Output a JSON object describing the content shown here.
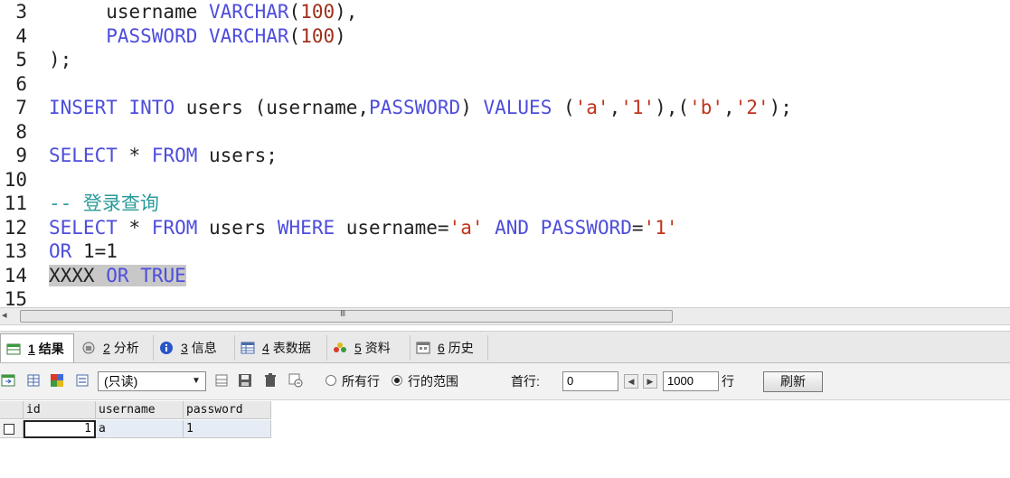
{
  "editor": {
    "lines": [
      {
        "no": "3",
        "tokens": [
          {
            "t": "     username ",
            "c": ""
          },
          {
            "t": "VARCHAR",
            "c": "kw"
          },
          {
            "t": "(",
            "c": ""
          },
          {
            "t": "100",
            "c": "num"
          },
          {
            "t": "),",
            "c": ""
          }
        ]
      },
      {
        "no": "4",
        "tokens": [
          {
            "t": "     ",
            "c": ""
          },
          {
            "t": "PASSWORD",
            "c": "kw"
          },
          {
            "t": " ",
            "c": ""
          },
          {
            "t": "VARCHAR",
            "c": "kw"
          },
          {
            "t": "(",
            "c": ""
          },
          {
            "t": "100",
            "c": "num"
          },
          {
            "t": ")",
            "c": ""
          }
        ]
      },
      {
        "no": "5",
        "tokens": [
          {
            "t": ");",
            "c": ""
          }
        ]
      },
      {
        "no": "6",
        "tokens": []
      },
      {
        "no": "7",
        "tokens": [
          {
            "t": "INSERT",
            "c": "kw"
          },
          {
            "t": " ",
            "c": ""
          },
          {
            "t": "INTO",
            "c": "kw"
          },
          {
            "t": " users (username,",
            "c": ""
          },
          {
            "t": "PASSWORD",
            "c": "kw"
          },
          {
            "t": ") ",
            "c": ""
          },
          {
            "t": "VALUES",
            "c": "kw"
          },
          {
            "t": " (",
            "c": ""
          },
          {
            "t": "'a'",
            "c": "str"
          },
          {
            "t": ",",
            "c": ""
          },
          {
            "t": "'1'",
            "c": "str"
          },
          {
            "t": "),(",
            "c": ""
          },
          {
            "t": "'b'",
            "c": "str"
          },
          {
            "t": ",",
            "c": ""
          },
          {
            "t": "'2'",
            "c": "str"
          },
          {
            "t": ");",
            "c": ""
          }
        ]
      },
      {
        "no": "8",
        "tokens": []
      },
      {
        "no": "9",
        "tokens": [
          {
            "t": "SELECT",
            "c": "kw"
          },
          {
            "t": " * ",
            "c": ""
          },
          {
            "t": "FROM",
            "c": "kw"
          },
          {
            "t": " users;",
            "c": ""
          }
        ]
      },
      {
        "no": "10",
        "tokens": []
      },
      {
        "no": "11",
        "tokens": [
          {
            "t": "-- 登录查询",
            "c": "cmt"
          }
        ]
      },
      {
        "no": "12",
        "tokens": [
          {
            "t": "SELECT",
            "c": "kw"
          },
          {
            "t": " * ",
            "c": ""
          },
          {
            "t": "FROM",
            "c": "kw"
          },
          {
            "t": " users ",
            "c": ""
          },
          {
            "t": "WHERE",
            "c": "kw"
          },
          {
            "t": " username=",
            "c": ""
          },
          {
            "t": "'a'",
            "c": "str"
          },
          {
            "t": " ",
            "c": ""
          },
          {
            "t": "AND",
            "c": "kw"
          },
          {
            "t": " ",
            "c": ""
          },
          {
            "t": "PASSWORD",
            "c": "kw"
          },
          {
            "t": "=",
            "c": ""
          },
          {
            "t": "'1'",
            "c": "str"
          }
        ]
      },
      {
        "no": "13",
        "tokens": [
          {
            "t": "OR",
            "c": "kw"
          },
          {
            "t": " 1=1",
            "c": ""
          }
        ]
      },
      {
        "no": "14",
        "tokens": [
          {
            "t": "XXXX",
            "c": "hl"
          },
          {
            "t": " ",
            "c": "hl"
          },
          {
            "t": "OR",
            "c": "kw hl"
          },
          {
            "t": " ",
            "c": "hl"
          },
          {
            "t": "TRUE",
            "c": "kw hl"
          }
        ]
      },
      {
        "no": "15",
        "tokens": []
      }
    ]
  },
  "scrollbar": {
    "grip": "III"
  },
  "tabs": [
    {
      "num": "1",
      "label": "结果",
      "icon": "result-icon",
      "active": true
    },
    {
      "num": "2",
      "label": "分析",
      "icon": "profile-icon",
      "active": false
    },
    {
      "num": "3",
      "label": "信息",
      "icon": "info-icon",
      "active": false
    },
    {
      "num": "4",
      "label": "表数据",
      "icon": "table-data-icon",
      "active": false
    },
    {
      "num": "5",
      "label": "资料",
      "icon": "objects-icon",
      "active": false
    },
    {
      "num": "6",
      "label": "历史",
      "icon": "history-icon",
      "active": false
    }
  ],
  "toolbar": {
    "mode_select": "(只读)",
    "radio_all": "所有行",
    "radio_range": "行的范围",
    "first_row_label": "首行:",
    "first_row_value": "0",
    "row_count_value": "1000",
    "rows_label": "行",
    "refresh_label": "刷新"
  },
  "grid": {
    "columns": [
      "id",
      "username",
      "password"
    ],
    "rows": [
      [
        "1",
        "a",
        "1"
      ]
    ]
  },
  "colors": {
    "keyword": "#4d4ddc",
    "string": "#c0341c",
    "comment": "#2b9a9a",
    "highlight": "#c8c8c8"
  }
}
